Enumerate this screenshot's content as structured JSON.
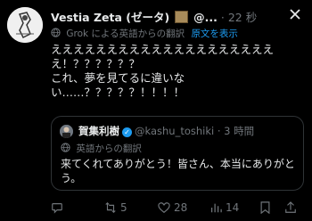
{
  "tweet": {
    "display_name": "Vestia Zeta (ゼータ)",
    "handle": "@...",
    "separator": "·",
    "time": "22 秒",
    "translation_note": "Grok による英語からの翻訳",
    "show_original_label": "原文を表示",
    "text": "えええええええええええええええええええええ！？？？？？？\nこれ、夢を見てるに違いない……？？？？？！！！！"
  },
  "quoted": {
    "display_name": "賀集利樹",
    "handle": "@kashu_toshiki",
    "separator": "·",
    "time": "3 時間",
    "translation_note": "英語からの翻訳",
    "text": "来てくれてありがとう！皆さん、本当にありがとう。"
  },
  "actions": {
    "replies": "",
    "reposts": "5",
    "likes": "28",
    "views": "14"
  },
  "colors": {
    "accent": "#1d9bf0",
    "muted": "#71767b",
    "background": "#000000"
  }
}
